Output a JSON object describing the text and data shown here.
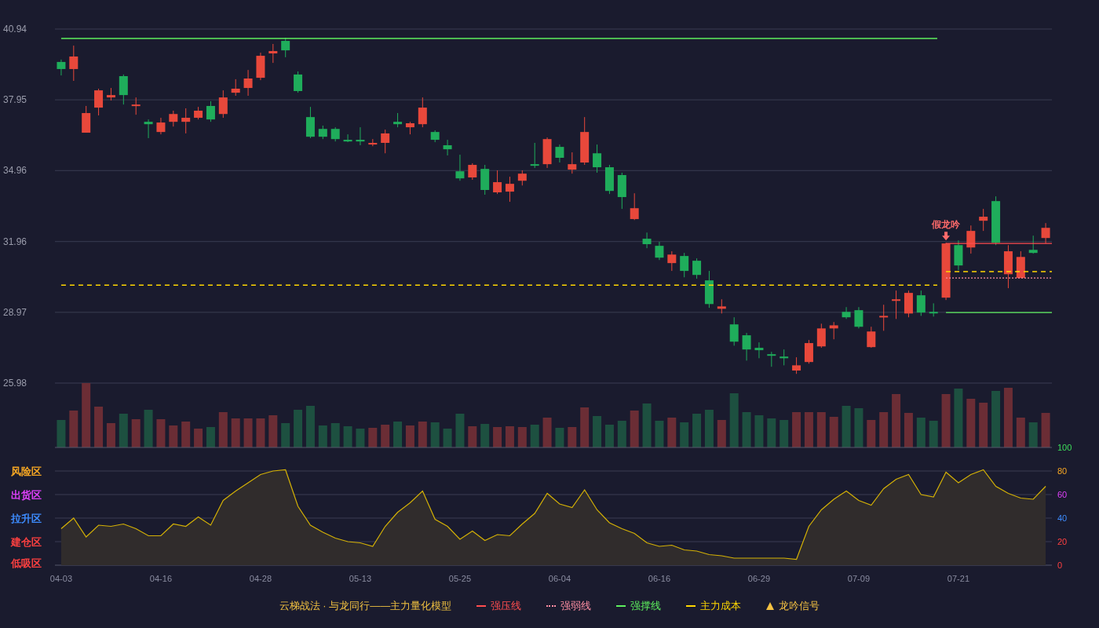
{
  "price_chart": {
    "chart_data": {
      "type": "candlestick",
      "categories": [
        null,
        null,
        null,
        null,
        null,
        null,
        null,
        null,
        null,
        null,
        null,
        null,
        null,
        null,
        null,
        null,
        null,
        null,
        null,
        null,
        null,
        null,
        null,
        null,
        null,
        null,
        null,
        null,
        null,
        null,
        null,
        null,
        null,
        null,
        null,
        null,
        null,
        null,
        null,
        null,
        null,
        null,
        null,
        null,
        null,
        null,
        null,
        null,
        null,
        null,
        null,
        null,
        null,
        null,
        null,
        null,
        null,
        null,
        null,
        null,
        null,
        null,
        null,
        null,
        null,
        null,
        null,
        null,
        null,
        null,
        null,
        null,
        null,
        null,
        null,
        null,
        null,
        null,
        null,
        null
      ],
      "ylim": [
        25.98,
        40.94
      ],
      "yticks": [
        40.94,
        37.95,
        34.96,
        31.96,
        28.97,
        25.98
      ],
      "grid": true,
      "ohlc": [
        [
          39.55,
          39.65,
          38.98,
          39.25
        ],
        [
          39.25,
          40.24,
          38.75,
          39.78
        ],
        [
          36.56,
          37.69,
          36.56,
          37.39
        ],
        [
          37.62,
          38.42,
          37.29,
          38.35
        ],
        [
          38.05,
          38.45,
          37.92,
          38.15
        ],
        [
          38.95,
          39.02,
          37.75,
          38.15
        ],
        [
          37.69,
          38.05,
          37.32,
          37.75
        ],
        [
          37.02,
          37.12,
          36.33,
          36.92
        ],
        [
          36.59,
          37.19,
          36.49,
          36.99
        ],
        [
          37.02,
          37.49,
          36.82,
          37.35
        ],
        [
          37.02,
          37.59,
          36.53,
          37.19
        ],
        [
          37.19,
          37.65,
          37.12,
          37.49
        ],
        [
          37.69,
          37.89,
          37.02,
          37.12
        ],
        [
          37.35,
          38.35,
          37.19,
          38.05
        ],
        [
          38.25,
          38.82,
          38.12,
          38.42
        ],
        [
          38.45,
          39.21,
          38.12,
          38.85
        ],
        [
          38.88,
          39.94,
          38.78,
          39.81
        ],
        [
          39.91,
          40.31,
          39.51,
          40.01
        ],
        [
          40.44,
          40.57,
          39.75,
          40.04
        ],
        [
          39.02,
          39.15,
          38.25,
          38.32
        ],
        [
          37.22,
          37.65,
          36.33,
          36.39
        ],
        [
          36.72,
          36.86,
          36.29,
          36.39
        ],
        [
          36.72,
          36.79,
          36.19,
          36.29
        ],
        [
          36.26,
          36.49,
          36.16,
          36.19
        ],
        [
          36.26,
          36.79,
          36.03,
          36.19
        ],
        [
          36.06,
          36.29,
          35.99,
          36.13
        ],
        [
          36.13,
          36.69,
          35.69,
          36.53
        ],
        [
          37.02,
          37.39,
          36.79,
          36.92
        ],
        [
          36.79,
          37.02,
          36.49,
          36.96
        ],
        [
          36.92,
          38.05,
          36.79,
          37.62
        ],
        [
          36.59,
          36.66,
          36.16,
          36.26
        ],
        [
          36.03,
          36.26,
          35.6,
          35.86
        ],
        [
          34.93,
          35.63,
          34.53,
          34.63
        ],
        [
          34.67,
          35.27,
          34.57,
          35.2
        ],
        [
          35.03,
          35.2,
          33.94,
          34.14
        ],
        [
          34.04,
          34.97,
          33.97,
          34.47
        ],
        [
          34.07,
          34.7,
          33.64,
          34.4
        ],
        [
          34.53,
          34.97,
          34.33,
          34.83
        ],
        [
          35.23,
          36.13,
          35.07,
          35.17
        ],
        [
          35.23,
          36.36,
          35.07,
          36.29
        ],
        [
          35.96,
          36.06,
          35.3,
          35.5
        ],
        [
          35.0,
          35.73,
          34.83,
          35.23
        ],
        [
          35.3,
          37.22,
          35.2,
          36.59
        ],
        [
          35.69,
          36.06,
          34.87,
          35.1
        ],
        [
          35.1,
          35.2,
          33.97,
          34.1
        ],
        [
          34.77,
          34.87,
          33.34,
          33.84
        ],
        [
          32.91,
          34.0,
          32.87,
          33.37
        ],
        [
          32.08,
          32.34,
          31.68,
          31.85
        ],
        [
          31.78,
          31.95,
          31.18,
          31.28
        ],
        [
          31.05,
          31.55,
          30.72,
          31.41
        ],
        [
          31.35,
          31.48,
          30.45,
          30.72
        ],
        [
          31.15,
          31.25,
          30.39,
          30.55
        ],
        [
          30.32,
          30.72,
          29.16,
          29.32
        ],
        [
          29.12,
          29.52,
          28.92,
          29.22
        ],
        [
          28.46,
          28.76,
          27.56,
          27.73
        ],
        [
          28.0,
          28.1,
          26.93,
          27.4
        ],
        [
          27.47,
          27.7,
          27.03,
          27.37
        ],
        [
          27.2,
          27.3,
          26.67,
          27.17
        ],
        [
          27.1,
          27.4,
          26.73,
          27.03
        ],
        [
          26.51,
          27.07,
          26.37,
          26.73
        ],
        [
          26.87,
          27.8,
          26.8,
          27.67
        ],
        [
          27.53,
          28.49,
          27.47,
          28.29
        ],
        [
          28.29,
          28.56,
          27.83,
          28.42
        ],
        [
          28.99,
          29.19,
          28.69,
          28.76
        ],
        [
          29.06,
          29.19,
          28.29,
          28.36
        ],
        [
          27.5,
          28.36,
          27.47,
          28.16
        ],
        [
          28.76,
          29.29,
          28.19,
          28.82
        ],
        [
          29.49,
          29.89,
          28.69,
          29.52
        ],
        [
          28.92,
          29.89,
          28.76,
          29.79
        ],
        [
          29.69,
          29.89,
          28.82,
          28.96
        ],
        [
          28.99,
          29.35,
          28.79,
          28.96
        ],
        [
          29.59,
          31.91,
          29.49,
          31.88
        ],
        [
          31.81,
          32.01,
          30.75,
          30.95
        ],
        [
          31.71,
          32.64,
          31.45,
          32.41
        ],
        [
          32.84,
          33.34,
          32.41,
          33.01
        ],
        [
          33.67,
          33.87,
          31.81,
          31.91
        ],
        [
          30.58,
          31.81,
          29.99,
          31.55
        ],
        [
          30.42,
          31.55,
          30.42,
          31.31
        ],
        [
          31.61,
          32.21,
          31.45,
          31.48
        ],
        [
          32.11,
          32.74,
          31.88,
          32.54
        ]
      ],
      "ref_lines": [
        {
          "axis": "y",
          "value": 40.54,
          "color": "#5ef05e",
          "line_style": "solid"
        },
        {
          "axis": "y",
          "value": 30.12,
          "color": "#ffd700",
          "line_style": "dashed"
        },
        {
          "axis": "y",
          "value": 31.88,
          "color": "#ff4d4f",
          "line_style": "solid"
        },
        {
          "axis": "y",
          "value": 30.42,
          "color": "#ff8fa3",
          "line_style": "dotted"
        },
        {
          "axis": "y",
          "value": 30.69,
          "color": "#ffd700",
          "line_style": "dashed"
        },
        {
          "axis": "y",
          "value": 28.96,
          "color": "#5ef05e",
          "line_style": "solid"
        }
      ],
      "annotations": [
        "假龙吟"
      ]
    }
  },
  "oscillator": {
    "zones": [
      {
        "label": "风险区",
        "color": "#f5a623"
      },
      {
        "label": "出货区",
        "color": "#e040fb"
      },
      {
        "label": "拉升区",
        "color": "#3d8bfd"
      },
      {
        "label": "建仓区",
        "color": "#ff4040"
      },
      {
        "label": "低吸区",
        "color": "#ff4040"
      }
    ],
    "chart_data": {
      "type": "area",
      "ylim": [
        0,
        100
      ],
      "yticks": [
        0,
        20,
        40,
        60,
        80,
        100
      ],
      "grid": true,
      "categories": [
        "04-03",
        null,
        null,
        null,
        null,
        null,
        null,
        null,
        "04-16",
        null,
        null,
        null,
        null,
        null,
        null,
        null,
        "04-28",
        null,
        null,
        null,
        null,
        null,
        null,
        null,
        "05-13",
        null,
        null,
        null,
        null,
        null,
        null,
        null,
        "05-25",
        null,
        null,
        null,
        null,
        null,
        null,
        null,
        "06-04",
        null,
        null,
        null,
        null,
        null,
        null,
        null,
        "06-16",
        null,
        null,
        null,
        null,
        null,
        null,
        null,
        "06-29",
        null,
        null,
        null,
        null,
        null,
        null,
        null,
        "07-09",
        null,
        null,
        null,
        null,
        null,
        null,
        null,
        "07-21",
        null,
        null,
        null,
        null,
        null,
        null,
        null
      ],
      "series": [
        {
          "color": "#d4b106",
          "values": [
            31,
            40,
            24,
            34,
            33,
            35,
            31,
            25,
            25,
            35,
            33,
            41,
            34,
            55,
            63,
            70,
            77,
            80,
            81,
            50,
            34,
            28,
            23,
            20,
            19,
            16,
            33,
            45,
            53,
            63,
            39,
            33,
            22,
            29,
            21,
            26,
            25,
            35,
            44,
            61,
            52,
            49,
            64,
            47,
            36,
            31,
            27,
            19,
            16,
            17,
            13,
            12,
            9,
            8,
            6,
            6,
            6,
            6,
            6,
            5,
            33,
            47,
            56,
            63,
            55,
            51,
            65,
            73,
            77,
            60,
            58,
            79,
            70,
            77,
            81,
            67,
            61,
            57,
            56,
            67
          ]
        }
      ]
    }
  },
  "legend": {
    "title": "云梯战法 · 与龙同行——主力量化模型",
    "items": [
      {
        "kind": "solid",
        "label": "强压线",
        "color": "#ff4d4f"
      },
      {
        "kind": "dotted",
        "label": "强弱线",
        "color": "#ff8fa3"
      },
      {
        "kind": "solid",
        "label": "强撑线",
        "color": "#5ef05e"
      },
      {
        "kind": "dashed",
        "label": "主力成本",
        "color": "#ffd700"
      },
      {
        "kind": "triangle",
        "label": "龙吟信号",
        "color": "#f5c242"
      }
    ]
  }
}
